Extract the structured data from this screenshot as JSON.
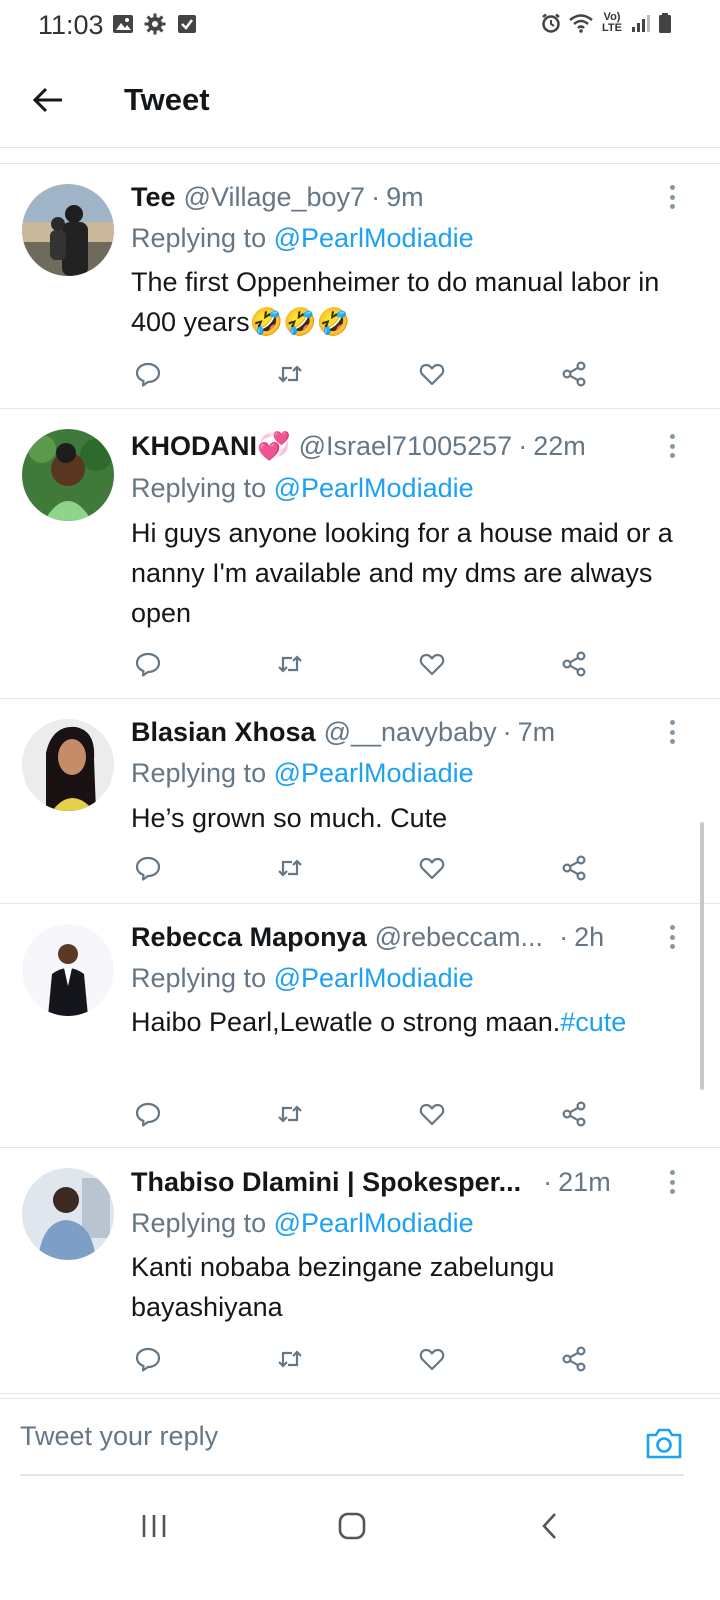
{
  "status_bar": {
    "time": "11:03",
    "network_label": "Vo) LTE"
  },
  "header": {
    "title": "Tweet"
  },
  "tweets": [
    {
      "name": "Tee",
      "handle": "@Village_boy7",
      "time": "9m",
      "replying_prefix": "Replying to",
      "replying_to": "@PearlModiadie",
      "text": "The first Oppenheimer to do manual labor in 400 years🤣🤣🤣"
    },
    {
      "name": "KHODANI💞",
      "handle": "@Israel71005257",
      "time": "22m",
      "replying_prefix": "Replying to",
      "replying_to": "@PearlModiadie",
      "text": "Hi guys anyone looking for a house maid or a nanny I'm available and my dms are always open"
    },
    {
      "name": "Blasian Xhosa",
      "handle": "@__navybaby",
      "time": "7m",
      "replying_prefix": "Replying to",
      "replying_to": "@PearlModiadie",
      "text": "He’s grown so much. Cute"
    },
    {
      "name": "Rebecca Maponya",
      "handle": "@rebeccam...",
      "time": "2h",
      "replying_prefix": "Replying to",
      "replying_to": "@PearlModiadie",
      "text": "Haibo Pearl,Lewatle o strong maan.",
      "hashtag": "#cute"
    },
    {
      "name": "Thabiso Dlamini | Spokesper...",
      "handle": "",
      "time": "21m",
      "replying_prefix": "Replying to",
      "replying_to": "@PearlModiadie",
      "text": "Kanti nobaba bezingane zabelungu bayashiyana"
    }
  ],
  "reply_box": {
    "placeholder": "Tweet your reply"
  },
  "icons": {
    "status_left": [
      "image-icon",
      "gear-icon",
      "checkbox-icon"
    ],
    "status_right": [
      "alarm-icon",
      "wifi-icon",
      "signal-icon",
      "battery-icon"
    ],
    "actions": [
      "reply-icon",
      "retweet-icon",
      "like-icon",
      "share-icon"
    ],
    "nav": [
      "recents-icon",
      "home-icon",
      "back-icon"
    ]
  },
  "colors": {
    "accent": "#1da1f2",
    "secondary_text": "#657786",
    "primary_text": "#14171a",
    "divider": "#e1e8ed"
  }
}
